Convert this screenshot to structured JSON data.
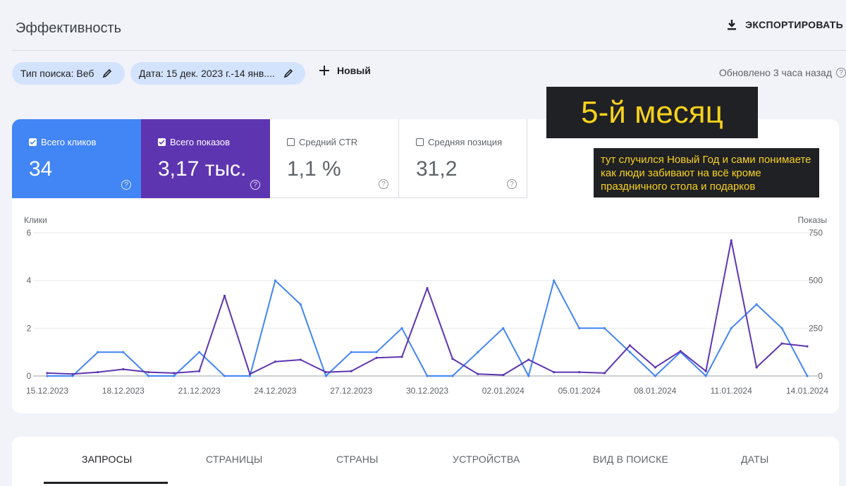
{
  "header": {
    "title": "Эффективность",
    "export_label": "ЭКСПОРТИРОВАТЬ"
  },
  "filters": {
    "search_type": "Тип поиска: Веб",
    "date": "Дата: 15 дек. 2023 г.-14 янв....",
    "new_label": "Новый",
    "updated": "Обновлено 3 часа назад"
  },
  "metrics": [
    {
      "label": "Всего кликов",
      "value": "34",
      "checked": true
    },
    {
      "label": "Всего показов",
      "value": "3,17 тыс.",
      "checked": true
    },
    {
      "label": "Средний CTR",
      "value": "1,1 %",
      "checked": false
    },
    {
      "label": "Средняя позиция",
      "value": "31,2",
      "checked": false
    }
  ],
  "overlays": {
    "big": "5-й месяц",
    "note": "тут случился Новый Год и сами понимаете как люди забивают на всё кроме праздничного стола и подарков"
  },
  "chart_data": {
    "type": "line",
    "x": [
      "15.12.2023",
      "16.12.2023",
      "17.12.2023",
      "18.12.2023",
      "19.12.2023",
      "20.12.2023",
      "21.12.2023",
      "22.12.2023",
      "23.12.2023",
      "24.12.2023",
      "25.12.2023",
      "26.12.2023",
      "27.12.2023",
      "28.12.2023",
      "29.12.2023",
      "30.12.2023",
      "31.12.2023",
      "01.01.2024",
      "02.01.2024",
      "03.01.2024",
      "04.01.2024",
      "05.01.2024",
      "06.01.2024",
      "07.01.2024",
      "08.01.2024",
      "09.01.2024",
      "10.01.2024",
      "11.01.2024",
      "12.01.2024",
      "13.01.2024",
      "14.01.2024"
    ],
    "xticks": [
      "15.12.2023",
      "18.12.2023",
      "21.12.2023",
      "24.12.2023",
      "27.12.2023",
      "30.12.2023",
      "02.01.2024",
      "05.01.2024",
      "08.01.2024",
      "11.01.2024",
      "14.01.2024"
    ],
    "series": [
      {
        "name": "Клики",
        "axis": "left",
        "color": "#4285f4",
        "values": [
          0,
          0,
          1,
          1,
          0,
          0,
          1,
          0,
          0,
          4,
          3,
          0,
          1,
          1,
          2,
          0,
          0,
          1,
          2,
          0,
          4,
          2,
          2,
          1,
          0,
          1,
          0,
          2,
          3,
          2,
          0
        ]
      },
      {
        "name": "Показы",
        "axis": "right",
        "color": "#5e35b1",
        "values": [
          15,
          10,
          20,
          35,
          20,
          15,
          25,
          420,
          10,
          75,
          85,
          20,
          25,
          95,
          100,
          460,
          90,
          10,
          5,
          85,
          20,
          20,
          15,
          160,
          45,
          130,
          25,
          710,
          45,
          170,
          155
        ]
      }
    ],
    "ylabel_left": "Клики",
    "ylim_left": [
      0,
      6
    ],
    "yticks_left": [
      0,
      2,
      4,
      6
    ],
    "ylabel_right": "Показы",
    "ylim_right": [
      0,
      750
    ],
    "yticks_right": [
      0,
      250,
      500,
      750
    ],
    "grid": true
  },
  "tabs": [
    "ЗАПРОСЫ",
    "СТРАНИЦЫ",
    "СТРАНЫ",
    "УСТРОЙСТВА",
    "ВИД В ПОИСКЕ",
    "ДАТЫ"
  ]
}
